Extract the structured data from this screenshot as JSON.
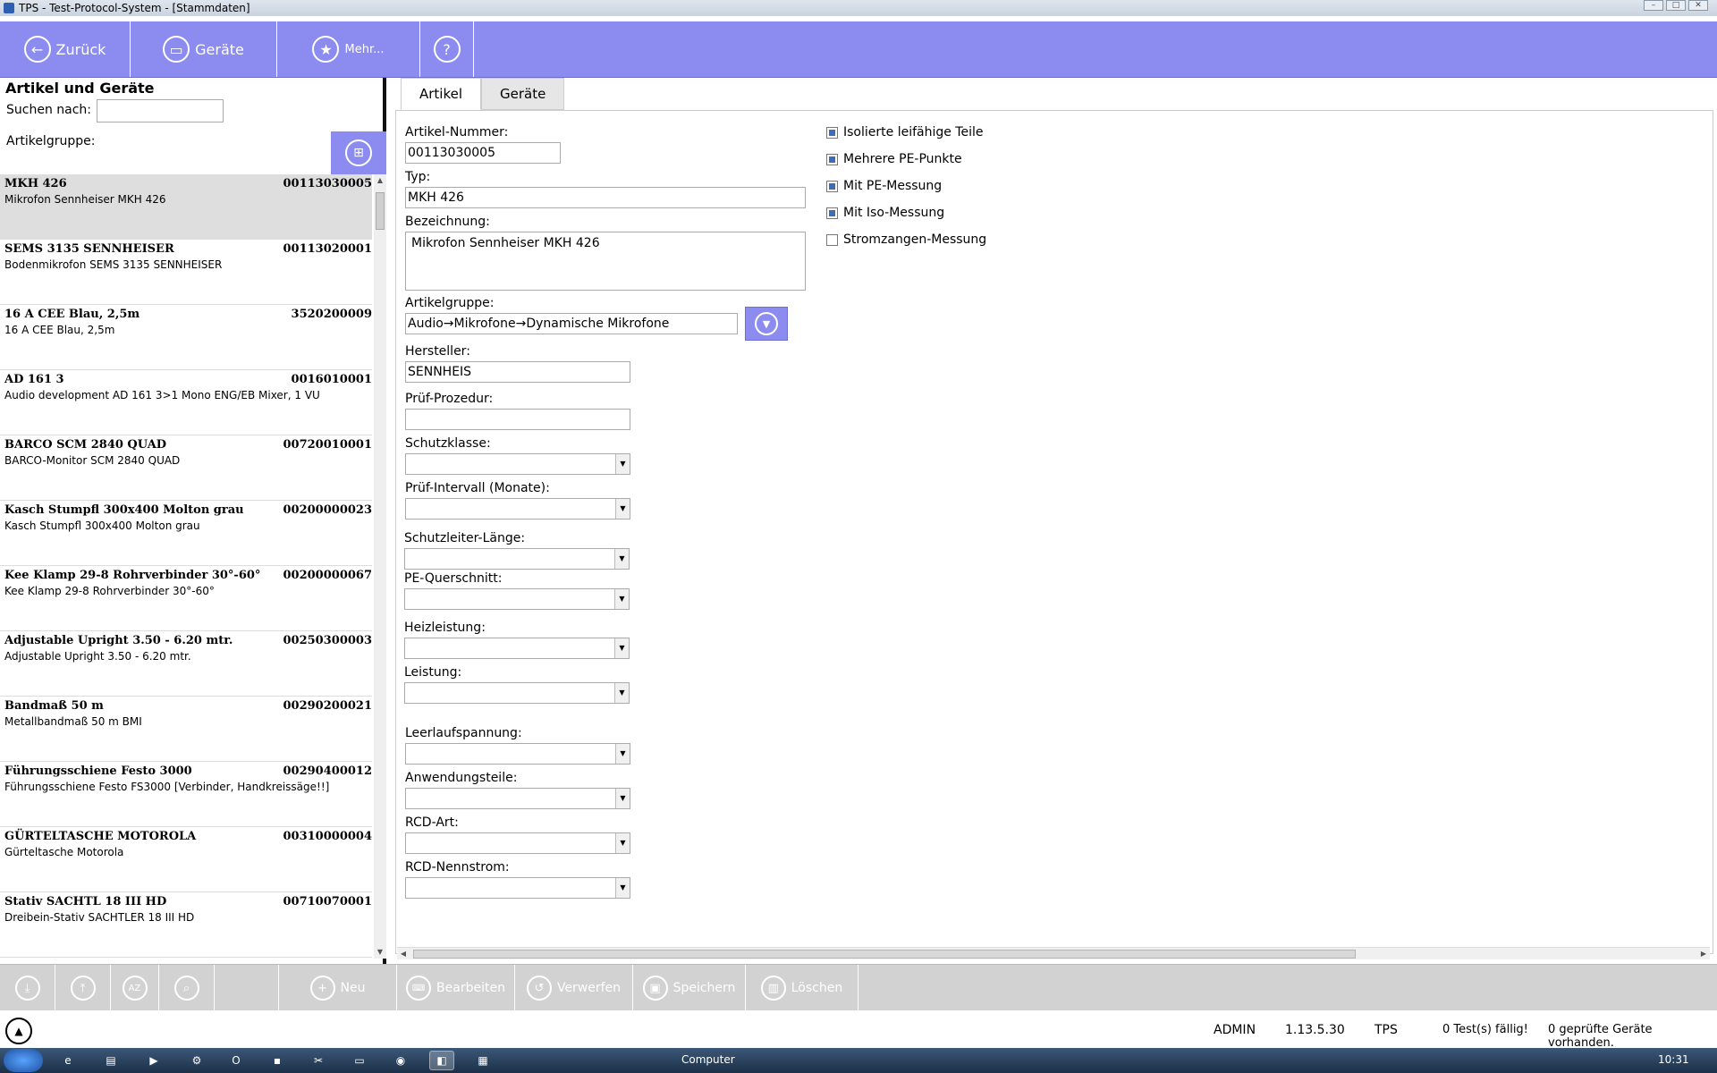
{
  "window": {
    "title": "TPS - Test-Protocol-System - [Stammdaten]"
  },
  "toolbar": {
    "back_label": "Zurück",
    "devices_label": "Geräte",
    "more_label": "Mehr...",
    "help_icon": "question-icon"
  },
  "left": {
    "title": "Artikel und Geräte",
    "search_label": "Suchen  nach:",
    "search_value": "",
    "group_label": "Artikelgruppe:",
    "items": [
      {
        "name": "MKH 426",
        "number": "00113030005",
        "desc": "Mikrofon Sennheiser MKH 426",
        "selected": true
      },
      {
        "name": "SEMS 3135 SENNHEISER",
        "number": "00113020001",
        "desc": "Bodenmikrofon SEMS 3135 SENNHEISER"
      },
      {
        "name": "16 A CEE Blau, 2,5m",
        "number": "3520200009",
        "desc": "16 A CEE Blau, 2,5m"
      },
      {
        "name": "AD 161 3",
        "number": "0016010001",
        "desc": "Audio development AD 161 3>1 Mono ENG/EB Mixer, 1 VU"
      },
      {
        "name": "BARCO SCM 2840 QUAD",
        "number": "00720010001",
        "desc": "BARCO-Monitor SCM 2840 QUAD"
      },
      {
        "name": "Kasch Stumpfl 300x400 Molton grau",
        "number": "00200000023",
        "desc": "Kasch Stumpfl 300x400 Molton grau"
      },
      {
        "name": "Kee Klamp 29-8 Rohrverbinder 30°-60°",
        "number": "00200000067",
        "desc": "Kee Klamp 29-8 Rohrverbinder 30°-60°"
      },
      {
        "name": "Adjustable Upright 3.50 - 6.20 mtr.",
        "number": "00250300003",
        "desc": "Adjustable Upright 3.50 - 6.20 mtr."
      },
      {
        "name": "Bandmaß 50 m",
        "number": "00290200021",
        "desc": "Metallbandmaß 50 m BMI"
      },
      {
        "name": "Führungsschiene Festo 3000",
        "number": "00290400012",
        "desc": "Führungsschiene Festo FS3000 [Verbinder, Handkreissäge!!]"
      },
      {
        "name": "GÜRTELTASCHE MOTOROLA",
        "number": "00310000004",
        "desc": "Gürteltasche Motorola"
      },
      {
        "name": "Stativ SACHTL 18 III HD",
        "number": "00710070001",
        "desc": "Dreibein-Stativ SACHTLER 18 III HD"
      }
    ]
  },
  "tabs": [
    "Artikel",
    "Geräte"
  ],
  "form": {
    "artikelnummer_label": "Artikel-Nummer:",
    "artikelnummer_value": "00113030005",
    "typ_label": "Typ:",
    "typ_value": "MKH 426",
    "bezeichnung_label": "Bezeichnung:",
    "bezeichnung_value": "Mikrofon Sennheiser MKH 426",
    "artikelgruppe_label": "Artikelgruppe:",
    "artikelgruppe_value": "Audio→Mikrofone→Dynamische Mikrofone",
    "hersteller_label": "Hersteller:",
    "hersteller_value": "SENNHEIS",
    "pruefprozedur_label": "Prüf-Prozedur:",
    "pruefprozedur_value": "",
    "schutzklasse_label": "Schutzklasse:",
    "pruefintervall_label": "Prüf-Intervall (Monate):",
    "schutzleiter_label": "Schutzleiter-Länge:",
    "pequerschnitt_label": "PE-Querschnitt:",
    "heizleistung_label": "Heizleistung:",
    "leistung_label": "Leistung:",
    "leerlauf_label": "Leerlaufspannung:",
    "anwendung_label": "Anwendungsteile:",
    "rcdart_label": "RCD-Art:",
    "rcdnenn_label": "RCD-Nennstrom:"
  },
  "checks": [
    {
      "label": "Isolierte leifähige Teile",
      "checked": true
    },
    {
      "label": "Mehrere PE-Punkte",
      "checked": true
    },
    {
      "label": "Mit PE-Messung",
      "checked": true
    },
    {
      "label": "Mit Iso-Messung",
      "checked": true
    },
    {
      "label": "Stromzangen-Messung",
      "checked": false
    }
  ],
  "bottombar": {
    "new_label": "Neu",
    "edit_label": "Bearbeiten",
    "discard_label": "Verwerfen",
    "save_label": "Speichern",
    "delete_label": "Löschen"
  },
  "status": {
    "user": "ADMIN",
    "version": "1.13.5.30",
    "app": "TPS",
    "due": "0 Test(s) fällig!",
    "checked": "0 geprüfte Geräte vorhanden."
  },
  "taskbar": {
    "computer_label": "Computer",
    "clock": "10:31"
  }
}
